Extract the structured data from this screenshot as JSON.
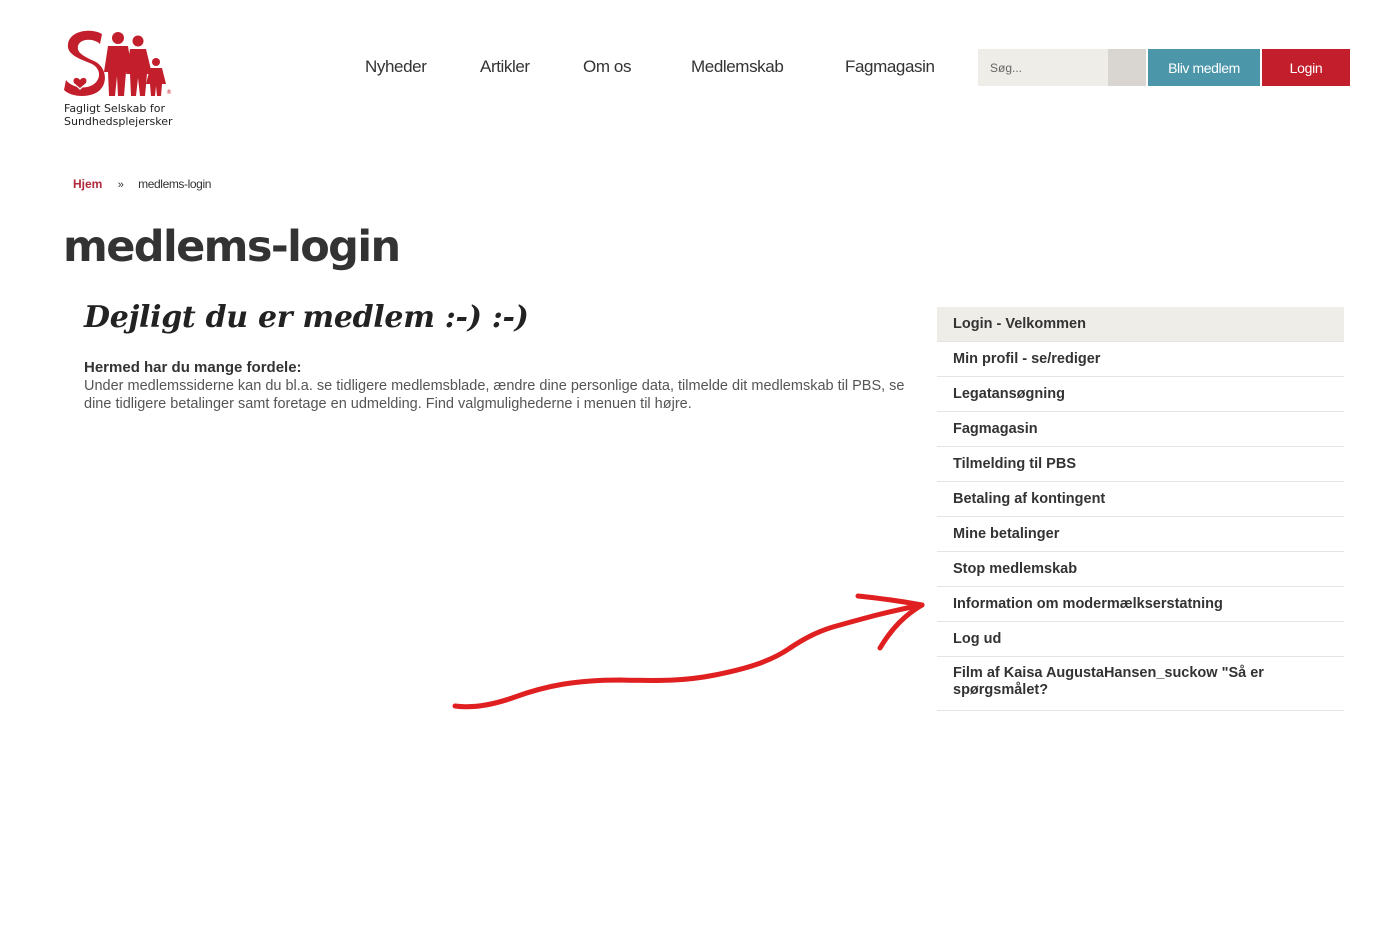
{
  "header": {
    "logo_alt_letters": "SM",
    "logo_line1": "Fagligt Selskab for",
    "logo_line2": "Sundhedsplejersker",
    "nav": [
      {
        "label": "Nyheder"
      },
      {
        "label": "Artikler"
      },
      {
        "label": "Om os"
      },
      {
        "label": "Medlemskab"
      },
      {
        "label": "Fagmagasin"
      }
    ],
    "search_placeholder": "Søg...",
    "member_button": "Bliv medlem",
    "login_button": "Login"
  },
  "breadcrumb": {
    "home": "Hjem",
    "separator": "»",
    "current": "medlems-login"
  },
  "page": {
    "title": "medlems-login"
  },
  "content": {
    "heading": "Dejligt du er medlem :-) :-)",
    "subhead": "Hermed har du mange fordele:",
    "body": "Under medlemssiderne kan du bl.a. se tidligere medlemsblade, ændre dine personlige data, tilmelde dit medlemskab til PBS, se dine tidligere betalinger samt foretage en udmelding.  Find valgmulighederne i menuen til højre."
  },
  "side_menu": {
    "items": [
      {
        "label": "Login - Velkommen",
        "active": true
      },
      {
        "label": "Min profil - se/rediger"
      },
      {
        "label": "Legatansøgning"
      },
      {
        "label": "Fagmagasin"
      },
      {
        "label": "Tilmelding til PBS"
      },
      {
        "label": "Betaling af kontingent"
      },
      {
        "label": "Mine betalinger"
      },
      {
        "label": "Stop medlemskab"
      },
      {
        "label": "Information om modermælkserstatning"
      },
      {
        "label": "Log ud"
      },
      {
        "label": "Film af Kaisa AugustaHansen_suckow \"Så er spørgsmålet?"
      }
    ]
  },
  "colors": {
    "brand_red": "#c21e2b",
    "member_teal": "#4b96a9",
    "active_menu_bg": "#efede8",
    "annotation_red": "#e02020"
  }
}
